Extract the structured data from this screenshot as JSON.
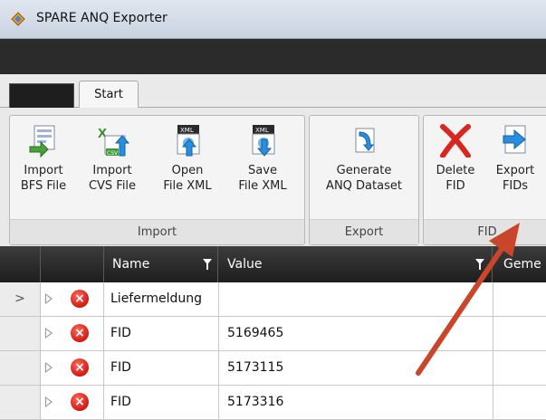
{
  "window": {
    "title": "SPARE ANQ Exporter"
  },
  "tabs": {
    "start": "Start"
  },
  "ribbon": {
    "import": {
      "label": "Import",
      "buttons": [
        {
          "line1": "Import",
          "line2": "BFS File",
          "icon": "import-bfs-icon"
        },
        {
          "line1": "Import",
          "line2": "CVS File",
          "icon": "import-csv-icon",
          "badge": "CSV"
        },
        {
          "line1": "Open",
          "line2": "File XML",
          "icon": "open-xml-icon",
          "badge": "XML"
        },
        {
          "line1": "Save",
          "line2": "File XML",
          "icon": "save-xml-icon",
          "badge": "XML"
        }
      ]
    },
    "export": {
      "label": "Export",
      "buttons": [
        {
          "line1": "Generate",
          "line2": "ANQ Dataset",
          "icon": "generate-icon"
        }
      ]
    },
    "fid": {
      "label": "FID",
      "buttons": [
        {
          "line1": "Delete",
          "line2": "FID",
          "icon": "delete-icon"
        },
        {
          "line1": "Export",
          "line2": "FIDs",
          "icon": "export-icon"
        }
      ]
    }
  },
  "grid": {
    "columns": {
      "name": "Name",
      "value": "Value",
      "third": "Geme"
    },
    "current_row_marker": ">",
    "rows": [
      {
        "name": "Liefermeldung",
        "value": ""
      },
      {
        "name": "FID",
        "value": "5169465"
      },
      {
        "name": "FID",
        "value": "5173115"
      },
      {
        "name": "FID",
        "value": "5173316"
      }
    ]
  },
  "colors": {
    "annotation_arrow": "#c9462a",
    "error": "#d21a12",
    "grid_header": "#2a2a2a"
  }
}
